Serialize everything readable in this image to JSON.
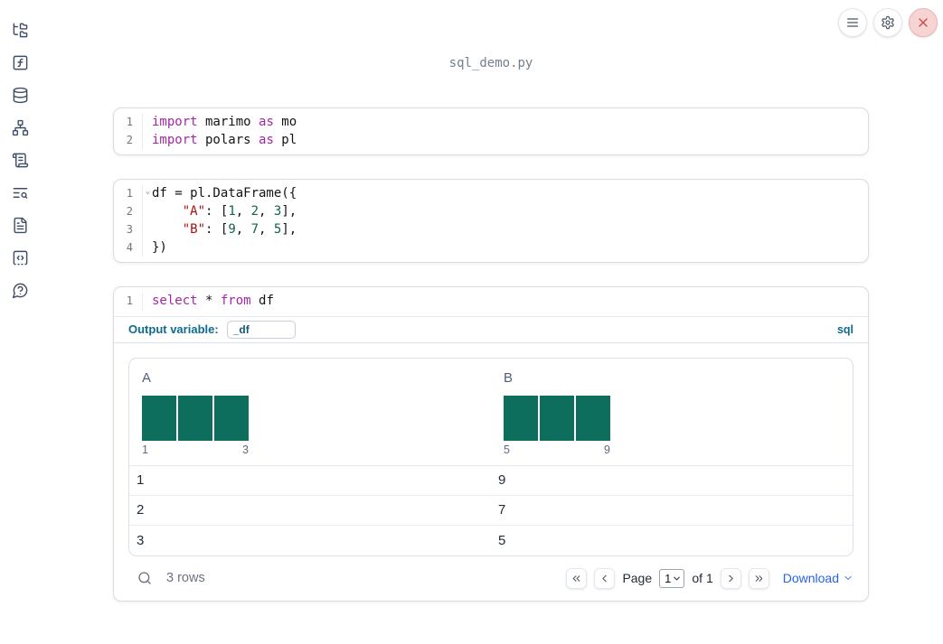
{
  "app": {
    "filename": "sql_demo.py"
  },
  "topbar": {
    "menu_button": "notebook menu",
    "settings_button": "settings",
    "close_button": "shutdown"
  },
  "sidebar": {
    "items": [
      {
        "key": "file-explorer",
        "icon": "folder-tree-icon"
      },
      {
        "key": "variables",
        "icon": "function-square-icon"
      },
      {
        "key": "data-sources",
        "icon": "database-icon"
      },
      {
        "key": "dependency-graph",
        "icon": "network-icon"
      },
      {
        "key": "logs",
        "icon": "scroll-icon"
      },
      {
        "key": "documentation",
        "icon": "text-search-icon"
      },
      {
        "key": "scratchpad",
        "icon": "file-text-icon"
      },
      {
        "key": "snippets",
        "icon": "code-square-icon"
      },
      {
        "key": "help",
        "icon": "help-chat-icon"
      }
    ]
  },
  "cells": [
    {
      "lines": [
        {
          "num": "1",
          "tokens": [
            {
              "t": "k",
              "x": "import"
            },
            {
              "t": "p",
              "x": " marimo "
            },
            {
              "t": "k",
              "x": "as"
            },
            {
              "t": "p",
              "x": " mo"
            }
          ]
        },
        {
          "num": "2",
          "tokens": [
            {
              "t": "k",
              "x": "import"
            },
            {
              "t": "p",
              "x": " polars "
            },
            {
              "t": "k",
              "x": "as"
            },
            {
              "t": "p",
              "x": " pl"
            }
          ]
        }
      ]
    },
    {
      "lines": [
        {
          "num": "1",
          "fold": true,
          "tokens": [
            {
              "t": "p",
              "x": "df = pl.DataFrame({"
            }
          ]
        },
        {
          "num": "2",
          "tokens": [
            {
              "t": "p",
              "x": "    "
            },
            {
              "t": "s",
              "x": "\"A\""
            },
            {
              "t": "p",
              "x": ": ["
            },
            {
              "t": "n",
              "x": "1"
            },
            {
              "t": "p",
              "x": ", "
            },
            {
              "t": "n",
              "x": "2"
            },
            {
              "t": "p",
              "x": ", "
            },
            {
              "t": "n",
              "x": "3"
            },
            {
              "t": "p",
              "x": "],"
            }
          ]
        },
        {
          "num": "3",
          "tokens": [
            {
              "t": "p",
              "x": "    "
            },
            {
              "t": "s",
              "x": "\"B\""
            },
            {
              "t": "p",
              "x": ": ["
            },
            {
              "t": "n",
              "x": "9"
            },
            {
              "t": "p",
              "x": ", "
            },
            {
              "t": "n",
              "x": "7"
            },
            {
              "t": "p",
              "x": ", "
            },
            {
              "t": "n",
              "x": "5"
            },
            {
              "t": "p",
              "x": "],"
            }
          ]
        },
        {
          "num": "4",
          "tokens": [
            {
              "t": "p",
              "x": "})"
            }
          ]
        }
      ]
    },
    {
      "lines": [
        {
          "num": "1",
          "tokens": [
            {
              "t": "k",
              "x": "select"
            },
            {
              "t": "p",
              "x": " * "
            },
            {
              "t": "k",
              "x": "from"
            },
            {
              "t": "p",
              "x": " df"
            }
          ]
        }
      ]
    }
  ],
  "sql_cell": {
    "output_variable_label": "Output variable:",
    "output_variable_value": "_df",
    "language_badge": "sql"
  },
  "table": {
    "columns": [
      {
        "name": "A",
        "hist": {
          "values": [
            1,
            1,
            1
          ],
          "min_label": "1",
          "max_label": "3"
        }
      },
      {
        "name": "B",
        "hist": {
          "values": [
            1,
            1,
            1
          ],
          "min_label": "5",
          "max_label": "9"
        }
      }
    ],
    "rows": [
      [
        "1",
        "9"
      ],
      [
        "2",
        "7"
      ],
      [
        "3",
        "5"
      ]
    ],
    "footer": {
      "row_count": "3 rows",
      "page_label": "Page",
      "page_value": "1",
      "of_label": "of 1",
      "download_label": "Download"
    }
  },
  "colors": {
    "keyword": "#a626a4",
    "string": "#aa1111",
    "number": "#116644",
    "histogram_bar": "#0e6e5d",
    "accent_blue": "#2563eb",
    "sql_accent": "#0f6a8f",
    "close_red": "#c84848"
  }
}
